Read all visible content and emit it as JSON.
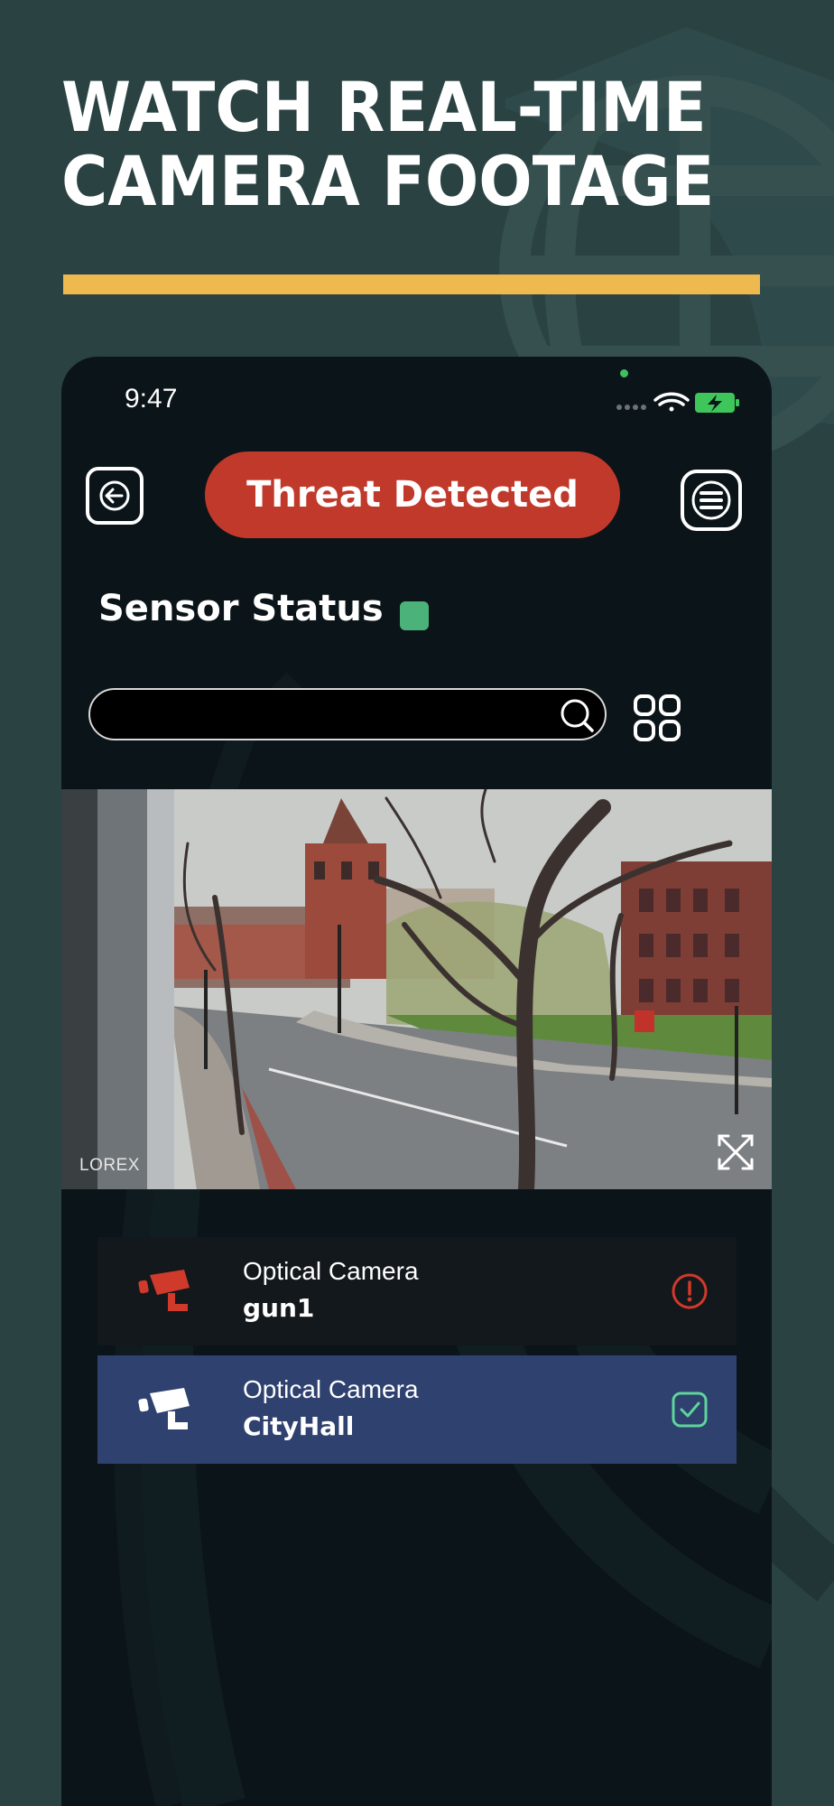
{
  "headline": {
    "line1": "WATCH REAL-TIME",
    "line2": "CAMERA FOOTAGE"
  },
  "colors": {
    "background": "#2b4242",
    "accent_bar": "#eeb94e",
    "threat": "#c0392b",
    "sensor_ok": "#4bb37a",
    "alert_icon": "#d03a2a",
    "selected_row": "#2e416f",
    "ok_check": "#5fd49a"
  },
  "status_bar": {
    "time": "9:47",
    "icons": [
      "signal-icon",
      "wifi-icon",
      "battery-charging-icon"
    ]
  },
  "header": {
    "back_icon": "arrow-left-icon",
    "threat_label": "Threat Detected",
    "menu_icon": "hamburger-menu-icon"
  },
  "sensor": {
    "title": "Sensor Status"
  },
  "search": {
    "value": "",
    "placeholder": "",
    "icon": "search-icon"
  },
  "grid_icon": "grid-view-icon",
  "feed": {
    "brand": "LOREX",
    "timestamp": "",
    "expand_icon": "expand-icon"
  },
  "cameras": [
    {
      "type": "Optical Camera",
      "name": "gun1",
      "status": "alert",
      "status_icon": "alert-circle-icon",
      "icon": "security-camera-icon"
    },
    {
      "type": "Optical Camera",
      "name": "CityHall",
      "status": "ok",
      "status_icon": "check-square-icon",
      "icon": "security-camera-icon"
    }
  ]
}
